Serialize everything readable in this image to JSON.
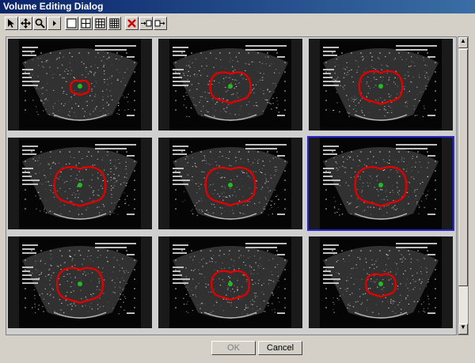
{
  "window": {
    "title": "Volume Editing Dialog"
  },
  "toolbar": {
    "tools": [
      "pointer-icon",
      "move-icon",
      "zoom-icon",
      "play-icon",
      "layout-1x1-icon",
      "layout-2x2-icon",
      "layout-3x3-icon",
      "layout-4x4-icon",
      "delete-icon",
      "insert-before-icon",
      "insert-after-icon"
    ]
  },
  "buttons": {
    "ok_label": "OK",
    "cancel_label": "Cancel"
  },
  "images": [
    {
      "text": "",
      "contour_scale": 0.35,
      "selected": false
    },
    {
      "text": "",
      "contour_scale": 0.75,
      "selected": false
    },
    {
      "text": "",
      "contour_scale": 0.8,
      "selected": false
    },
    {
      "text": "",
      "contour_scale": 0.95,
      "selected": false
    },
    {
      "text": "",
      "contour_scale": 0.92,
      "selected": false
    },
    {
      "text": "",
      "contour_scale": 0.95,
      "selected": true
    },
    {
      "text": "",
      "contour_scale": 0.85,
      "selected": false
    },
    {
      "text": "",
      "contour_scale": 0.7,
      "selected": false
    },
    {
      "text": "",
      "contour_scale": 0.55,
      "selected": false
    }
  ],
  "colors": {
    "contour": "#e00000",
    "center_marker": "#22bb22",
    "selection": "#2a2acc"
  }
}
